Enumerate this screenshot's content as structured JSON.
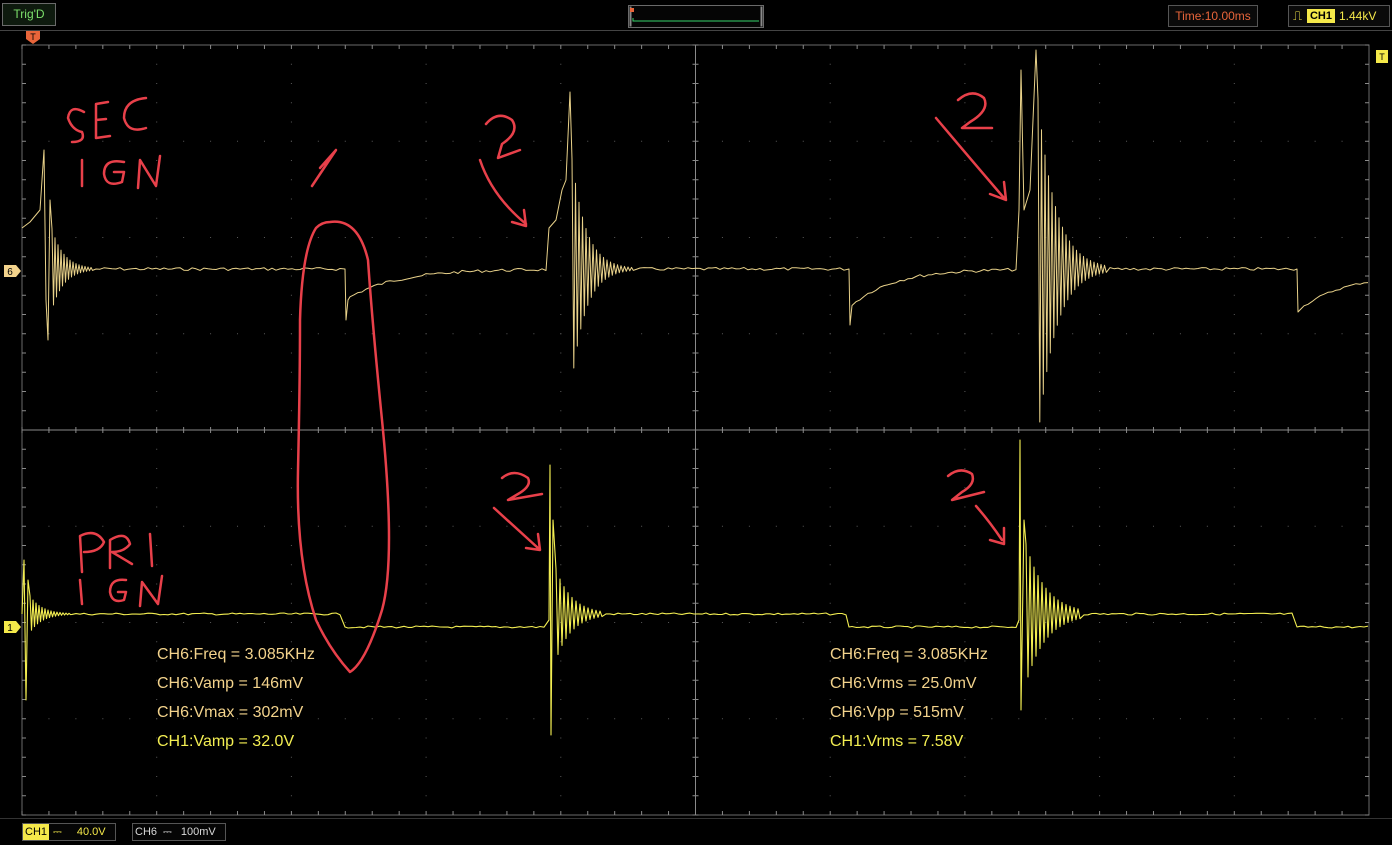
{
  "topbar": {
    "trigger_status": "Trig'D",
    "time_base": "Time:10.00ms",
    "trigger_source": "CH1",
    "trigger_level": "1.44kV",
    "trigger_edge_icon": "rising-edge-icon"
  },
  "markers": {
    "trigger_position": "T",
    "trigger_level_marker": "T",
    "ch6_ground": "6",
    "ch1_ground": "1"
  },
  "channels": {
    "ch1": {
      "label": "CH1",
      "coupling_icon": "dc-coupling-icon",
      "scale": "40.0V",
      "color": "#f3ee52"
    },
    "ch6": {
      "label": "CH6",
      "coupling_icon": "dc-coupling-icon",
      "scale": "100mV",
      "color": "#e9d28a"
    }
  },
  "annotations": {
    "sec_line1": "SEC",
    "sec_line2": "IGN",
    "pri_line1": "PRI",
    "pri_line2": "IGN",
    "marker_1": "1",
    "marker_2a": "2",
    "marker_2b": "2",
    "marker_2c": "2",
    "marker_2d": "2"
  },
  "measurements_left": [
    {
      "text": "CH6:Freq = 3.085KHz",
      "color": "#f3d38c"
    },
    {
      "text": "CH6:Vamp = 146mV",
      "color": "#f3d38c"
    },
    {
      "text": "CH6:Vmax = 302mV",
      "color": "#f3d38c"
    },
    {
      "text": "CH1:Vamp = 32.0V",
      "color": "#f3ee52"
    }
  ],
  "measurements_right": [
    {
      "text": "CH6:Freq = 3.085KHz",
      "color": "#f3d38c"
    },
    {
      "text": "CH6:Vrms = 25.0mV",
      "color": "#f3d38c"
    },
    {
      "text": "CH6:Vpp = 515mV",
      "color": "#f3d38c"
    },
    {
      "text": "CH1:Vrms = 7.58V",
      "color": "#f3ee52"
    }
  ],
  "colors": {
    "grid": "#5a5a5a",
    "annotation": "#e8404a",
    "ch6_trace": "#e9d28a",
    "ch1_trace": "#f3ee52"
  }
}
